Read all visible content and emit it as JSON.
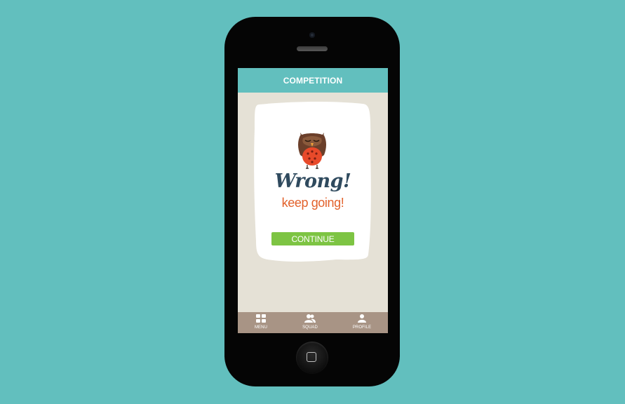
{
  "header": {
    "title": "COMPETITION"
  },
  "result": {
    "title": "Wrong!",
    "subtitle": "keep going!",
    "button_label": "CONTINUE"
  },
  "tabs": [
    {
      "label": "MENU",
      "icon": "grid-icon"
    },
    {
      "label": "SQUAD",
      "icon": "group-icon"
    },
    {
      "label": "PROFILE",
      "icon": "person-icon"
    }
  ],
  "colors": {
    "background": "#62bfbe",
    "header": "#62bfbe",
    "screen": "#e5e1d6",
    "card": "#ffffff",
    "title": "#2f4a5e",
    "subtitle": "#e2612b",
    "button": "#7dc443",
    "tabbar": "#a89485"
  }
}
